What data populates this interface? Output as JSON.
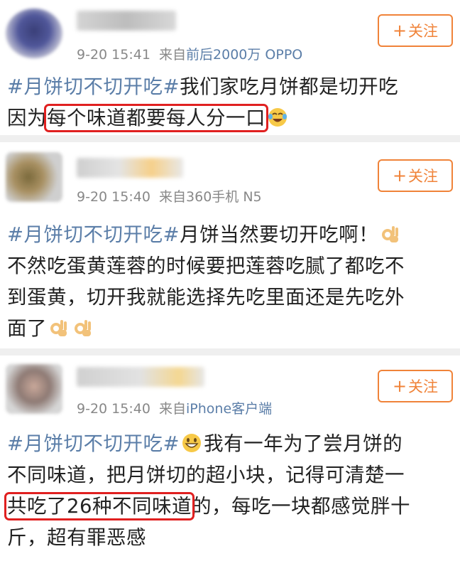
{
  "accent": "#f08339",
  "link_color": "#5b7ea8",
  "highlight_color": "#e02020",
  "follow_label": "关注",
  "posts": [
    {
      "time": "9-20 15:41",
      "source_prefix": "来自",
      "source_name": "前后2000万 OPPO",
      "hashtag": "#月饼切不切开吃#",
      "text_a": "我们家吃月饼都是切开吃",
      "text_b": "因为",
      "highlight": "每个味道都要每人分一口",
      "emoji": "laughing-tears-emoji"
    },
    {
      "time": "9-20 15:40",
      "source_prefix": "来自",
      "source_name": "360手机 N5",
      "hashtag": "#月饼切不切开吃#",
      "line1_rest": "月饼当然要切开吃啊！",
      "line2": "不然吃蛋黄莲蓉的时候要把莲蓉吃腻了都吃不",
      "line3": "到蛋黄，切开我就能选择先吃里面还是先吃外",
      "line4": "面了",
      "emoji": "ok-hand-emoji"
    },
    {
      "time": "9-20 15:40",
      "source_prefix": "来自",
      "source_name": "iPhone客户端",
      "hashtag": "#月饼切不切开吃#",
      "line1_rest": "我有一年为了尝月饼的",
      "line2": "不同味道，把月饼切的超小块，记得可清楚一",
      "highlight": "共吃了26种不同味道",
      "line3_rest": "的，每吃一块都感觉胖十",
      "line4": "斤，超有罪恶感",
      "emoji": "grinning-emoji"
    }
  ]
}
